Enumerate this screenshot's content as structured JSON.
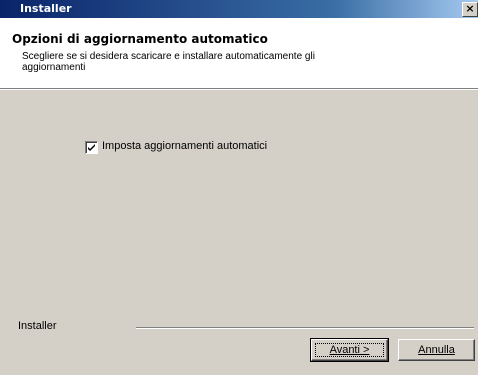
{
  "window": {
    "title": "Installer",
    "close_glyph": "×"
  },
  "header": {
    "title": "Opzioni di aggiornamento automatico",
    "subtitle": "Scegliere se si desidera scaricare e installare automaticamente gli aggiornamenti"
  },
  "options": {
    "auto_update_label": "Imposta aggiornamenti automatici",
    "auto_update_checked": true
  },
  "footer": {
    "brand": "Installer"
  },
  "buttons": {
    "next_label": "Avanti >",
    "cancel_label": "Annulla"
  }
}
